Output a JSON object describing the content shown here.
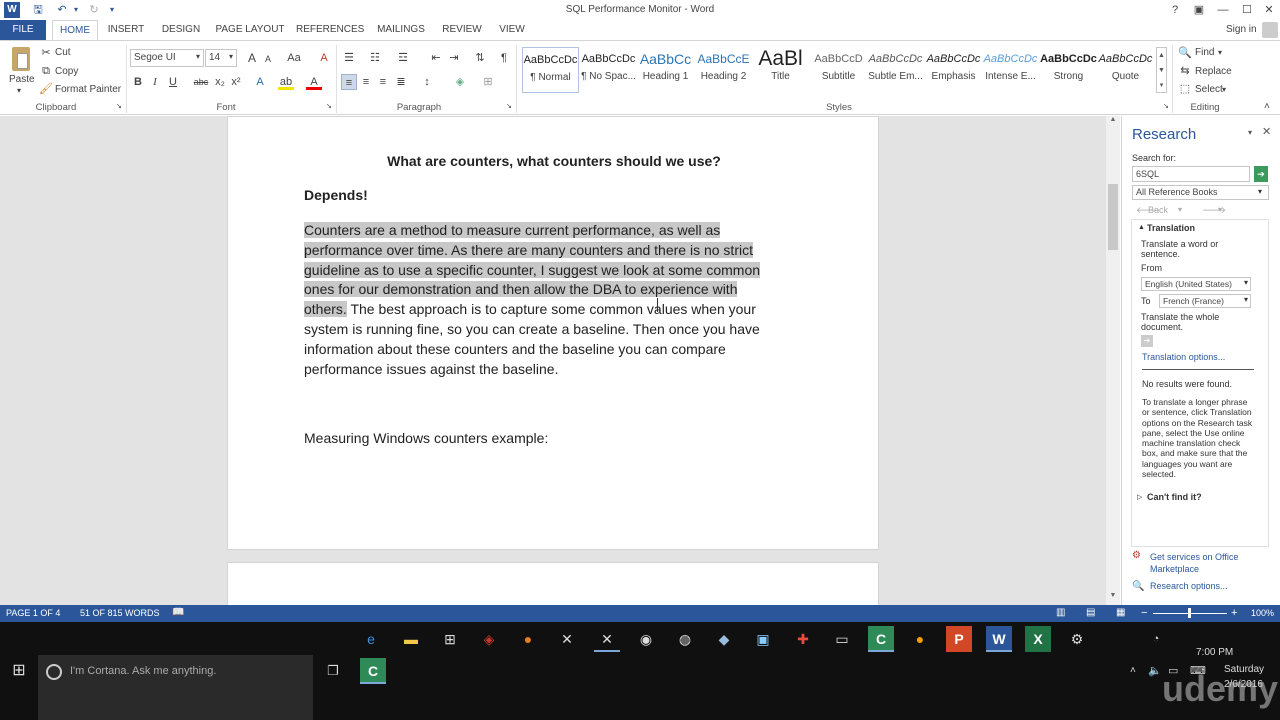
{
  "title_bar": {
    "title": "SQL Performance Monitor - Word",
    "help": "?",
    "ribbon_display": "▣",
    "minimize": "—",
    "maximize": "☐",
    "close": "✕",
    "sign_in": "Sign in"
  },
  "tabs": [
    "FILE",
    "HOME",
    "INSERT",
    "DESIGN",
    "PAGE LAYOUT",
    "REFERENCES",
    "MAILINGS",
    "REVIEW",
    "VIEW"
  ],
  "clipboard": {
    "paste": "Paste",
    "cut": "Cut",
    "copy": "Copy",
    "format_painter": "Format Painter",
    "label": "Clipboard"
  },
  "font": {
    "name": "Segoe UI",
    "size": "14",
    "grow": "A",
    "shrink": "A",
    "case": "Aa",
    "clear": "A",
    "bold": "B",
    "italic": "I",
    "underline": "U",
    "strike": "abc",
    "sub": "x₂",
    "sup": "x²",
    "effects": "A",
    "highlight": "ab",
    "color": "A",
    "label": "Font"
  },
  "paragraph": {
    "label": "Paragraph"
  },
  "styles": {
    "items": [
      {
        "preview": "AaBbCcDc",
        "name": "¶ Normal"
      },
      {
        "preview": "AaBbCcDc",
        "name": "¶ No Spac..."
      },
      {
        "preview": "AaBbCc",
        "name": "Heading 1"
      },
      {
        "preview": "AaBbCcE",
        "name": "Heading 2"
      },
      {
        "preview": "AaBl",
        "name": "Title"
      },
      {
        "preview": "AaBbCcD",
        "name": "Subtitle"
      },
      {
        "preview": "AaBbCcDc",
        "name": "Subtle Em..."
      },
      {
        "preview": "AaBbCcDc",
        "name": "Emphasis"
      },
      {
        "preview": "AaBbCcDc",
        "name": "Intense E..."
      },
      {
        "preview": "AaBbCcDc",
        "name": "Strong"
      },
      {
        "preview": "AaBbCcDc",
        "name": "Quote"
      }
    ],
    "label": "Styles"
  },
  "editing": {
    "find": "Find",
    "replace": "Replace",
    "select": "Select",
    "label": "Editing"
  },
  "document": {
    "heading": "What are counters, what counters should we use?",
    "depends": "Depends!",
    "para_lines": [
      "Counters are a method to measure current performance, as well as",
      "performance over time.  As there are many counters and there is no strict",
      "guideline as to use a specific counter, I suggest we look at some common",
      "ones for our demonstration and then allow the DBA to experience with",
      "others.",
      " The best approach is to capture some common values when your",
      "system is running fine, so you can create a baseline.  Then once you have",
      "information about these counters and the baseline you can compare",
      "performance issues against the baseline."
    ],
    "example": "Measuring Windows counters example:"
  },
  "research": {
    "title": "Research",
    "search_label": "Search for:",
    "search_value": "6SQL",
    "books": "All Reference Books",
    "back": "Back",
    "translation": "Translation",
    "translate_word": "Translate a word or sentence.",
    "from_label": "From",
    "from_value": "English (United States)",
    "to_label": "To",
    "to_value": "French (France)",
    "translate_doc": "Translate the whole document.",
    "translation_options": "Translation options...",
    "no_results": "No results were found.",
    "help_text": "To translate a longer phrase or sentence, click Translation options on the Research task pane, select the Use online machine translation check box, and make sure that the languages you want are selected.",
    "cant_find": "Can't find it?",
    "services": "Get services on Office Marketplace",
    "research_options": "Research options..."
  },
  "status": {
    "page": "PAGE 1 OF 4",
    "words": "51 OF 815 WORDS",
    "zoom": "100%"
  },
  "taskbar": {
    "cortana": "I'm Cortana. Ask me anything.",
    "time": "7:00 PM",
    "day": "Saturday",
    "date": "2/6/2016",
    "watermark": "udemy"
  }
}
